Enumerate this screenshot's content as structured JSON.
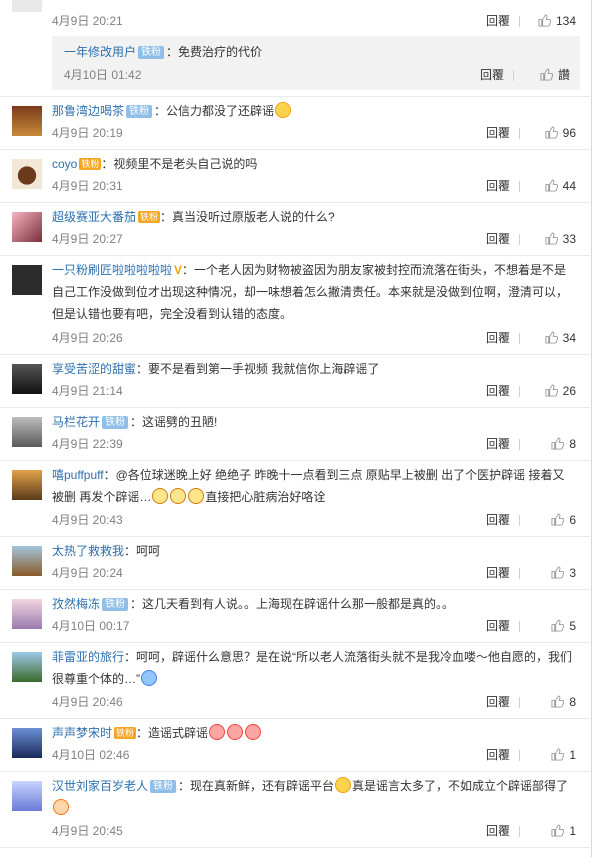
{
  "comments": [
    {
      "text_segments": [],
      "date": "4月9日 20:21",
      "reply_label": "回覆",
      "likes": "134",
      "reply": {
        "username": "一年修改用户",
        "badge": "铁粉",
        "sep": "：",
        "text": "免费治疗的代价",
        "date": "4月10日 01:42",
        "reply_label": "回覆",
        "likes": "讚"
      }
    },
    {
      "username": "那鲁湾边喝茶",
      "badge": "铁粉",
      "sep": "：",
      "text": "公信力都没了还辟谣",
      "emoji": [
        "smile"
      ],
      "date": "4月9日 20:19",
      "reply_label": "回覆",
      "likes": "96"
    },
    {
      "username": "coyo",
      "vip": "铁粉",
      "sep": "：",
      "text": "视频里不是老头自己说的吗",
      "date": "4月9日 20:31",
      "reply_label": "回覆",
      "likes": "44"
    },
    {
      "username": "超级赛亚大番茄",
      "vip": "铁粉",
      "sep": "：",
      "text": "真当没听过原版老人说的什么?",
      "date": "4月9日 20:27",
      "reply_label": "回覆",
      "likes": "33"
    },
    {
      "username": "一只粉刷匠啦啦啦啦啦",
      "verified": "V",
      "sep": "：",
      "text": "一个老人因为财物被盗因为朋友家被封控而流落在街头，不想着是不是自己工作没做到位才出现这种情况，却一味想着怎么撇清责任。本来就是没做到位啊，澄清可以，但是认错也要有吧，完全没看到认错的态度。",
      "date": "4月9日 20:26",
      "reply_label": "回覆",
      "likes": "34"
    },
    {
      "username": "享受苦涩的甜蜜",
      "sep": "：",
      "text": "要不是看到第一手视频 我就信你上海辟谣了",
      "date": "4月9日 21:14",
      "reply_label": "回覆",
      "likes": "26"
    },
    {
      "username": "马栏花开",
      "badge": "铁粉",
      "sep": "：",
      "text": "这谣劈的丑陋!",
      "date": "4月9日 22:39",
      "reply_label": "回覆",
      "likes": "8"
    },
    {
      "username": "嘻puffpuff",
      "sep": "：",
      "text": "@各位球迷晚上好 绝绝子 昨晚十一点看到三点 原贴早上被删 出了个医护辟谣 接着又被删 再发个辟谣…",
      "text2": "直接把心脏病治好咯诠",
      "date": "4月9日 20:43",
      "reply_label": "回覆",
      "likes": "6"
    },
    {
      "username": "太热了救救我",
      "sep": "：",
      "text": "呵呵",
      "date": "4月9日 20:24",
      "reply_label": "回覆",
      "likes": "3"
    },
    {
      "username": "孜然梅冻",
      "badge": "铁粉",
      "sep": "：",
      "text": "这几天看到有人说。。上海现在辟谣什么那一般都是真的。。",
      "date": "4月10日 00:17",
      "reply_label": "回覆",
      "likes": "5"
    },
    {
      "username": "菲雷亚的旅行",
      "sep": "：",
      "text": "呵呵，辟谣什么意思？是在说“所以老人流落街头就不是我冷血喽～他自愿的，我们很尊重个体的…”",
      "date": "4月9日 20:46",
      "reply_label": "回覆",
      "likes": "8"
    },
    {
      "username": "声声梦宋时",
      "vip": "铁粉",
      "sep": "：",
      "text": "造谣式辟谣",
      "date": "4月10日 02:46",
      "reply_label": "回覆",
      "likes": "1"
    },
    {
      "username": "汉世刘家百岁老人",
      "badge": "铁粉",
      "sep": "：",
      "text": "现在真新鲜，还有辟谣平台",
      "text2": "真是谣言太多了，不如成立个辟谣部得了",
      "date": "4月9日 20:45",
      "reply_label": "回覆",
      "likes": "1"
    }
  ]
}
